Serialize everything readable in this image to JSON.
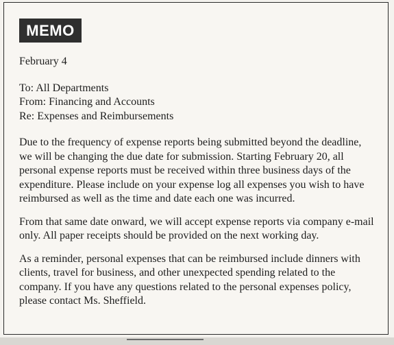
{
  "memo": {
    "badge_label": "MEMO",
    "date": "February 4",
    "to": "To: All Departments",
    "from": "From: Financing and Accounts",
    "re": "Re: Expenses and Reimbursements",
    "paragraphs": [
      "Due to the frequency of expense reports being submitted beyond the deadline, we will be changing the due date for submission. Starting February 20, all personal expense reports must be received within three business days of the expenditure. Please include on your expense log all expenses you wish to have reimbursed as well as the time and date each one was incurred.",
      "From that same date onward, we will accept expense reports via company e-mail only. All paper receipts should be provided on the next working day.",
      "As a reminder, personal expenses that can be reimbursed include dinners with clients, travel for business, and other unexpected spending related to the company. If you have any questions related to the personal expenses policy, please contact Ms. Sheffield."
    ]
  }
}
